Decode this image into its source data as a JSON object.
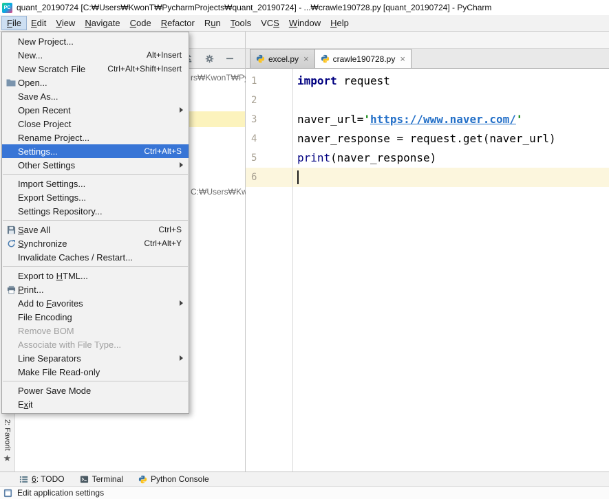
{
  "title_bar": {
    "app_icon_text": "PC",
    "title": "quant_20190724 [C:₩Users₩KwonT₩PycharmProjects₩quant_20190724] - ...₩crawle190728.py [quant_20190724] - PyCharm"
  },
  "menu_bar": {
    "items": [
      {
        "label": "File",
        "mnemonic": "F",
        "active": true
      },
      {
        "label": "Edit",
        "mnemonic": "E"
      },
      {
        "label": "View",
        "mnemonic": "V"
      },
      {
        "label": "Navigate",
        "mnemonic": "N"
      },
      {
        "label": "Code",
        "mnemonic": "C"
      },
      {
        "label": "Refactor",
        "mnemonic": "R"
      },
      {
        "label": "Run",
        "mnemonic": "u"
      },
      {
        "label": "Tools",
        "mnemonic": "T"
      },
      {
        "label": "VCS",
        "mnemonic": "S"
      },
      {
        "label": "Window",
        "mnemonic": "W"
      },
      {
        "label": "Help",
        "mnemonic": "H"
      }
    ]
  },
  "file_menu": {
    "groups": [
      {
        "items": [
          {
            "label": "New Project..."
          },
          {
            "label": "New...",
            "shortcut": "Alt+Insert"
          },
          {
            "label": "New Scratch File",
            "shortcut": "Ctrl+Alt+Shift+Insert"
          },
          {
            "label": "Open...",
            "icon": "folder-icon"
          },
          {
            "label": "Save As..."
          },
          {
            "label": "Open Recent",
            "submenu": true
          },
          {
            "label": "Close Project"
          },
          {
            "label": "Rename Project..."
          },
          {
            "label": "Settings...",
            "shortcut": "Ctrl+Alt+S",
            "selected": true
          },
          {
            "label": "Other Settings",
            "submenu": true
          }
        ]
      },
      {
        "items": [
          {
            "label": "Import Settings..."
          },
          {
            "label": "Export Settings..."
          },
          {
            "label": "Settings Repository..."
          }
        ]
      },
      {
        "items": [
          {
            "label": "Save All",
            "mnemonic": "S",
            "shortcut": "Ctrl+S",
            "icon": "save-icon"
          },
          {
            "label": "Synchronize",
            "mnemonic": "S",
            "shortcut": "Ctrl+Alt+Y",
            "icon": "sync-icon"
          },
          {
            "label": "Invalidate Caches / Restart..."
          }
        ]
      },
      {
        "items": [
          {
            "label": "Export to HTML...",
            "mnemonic": "H"
          },
          {
            "label": "Print...",
            "mnemonic": "P",
            "icon": "printer-icon"
          },
          {
            "label": "Add to Favorites",
            "mnemonic": "F",
            "submenu": true
          },
          {
            "label": "File Encoding"
          },
          {
            "label": "Remove BOM",
            "disabled": true
          },
          {
            "label": "Associate with File Type...",
            "disabled": true
          },
          {
            "label": "Line Separators",
            "submenu": true
          },
          {
            "label": "Make File Read-only"
          }
        ]
      },
      {
        "items": [
          {
            "label": "Power Save Mode"
          },
          {
            "label": "Exit",
            "mnemonic": "x"
          }
        ]
      }
    ]
  },
  "project_panel": {
    "path_fragment_top": "rs₩KwonT₩Py",
    "path_fragment_bottom": "C:₩Users₩Kwo"
  },
  "left_stripe": {
    "favorites_label": "2: Favorit"
  },
  "editor": {
    "tabs": [
      {
        "label": "excel.py",
        "active": false
      },
      {
        "label": "crawle190728.py",
        "active": true
      }
    ],
    "current_line": 6,
    "lines": [
      {
        "n": "1",
        "segments": [
          {
            "t": "import",
            "c": "kw"
          },
          {
            "t": " request",
            "c": "plain"
          }
        ]
      },
      {
        "n": "2",
        "segments": []
      },
      {
        "n": "3",
        "segments": [
          {
            "t": "naver_url=",
            "c": "plain"
          },
          {
            "t": "'",
            "c": "str"
          },
          {
            "t": "https://www.naver.com/",
            "c": "url"
          },
          {
            "t": "'",
            "c": "str"
          }
        ]
      },
      {
        "n": "4",
        "segments": [
          {
            "t": "naver_response = request.get(naver_url)",
            "c": "plain"
          }
        ]
      },
      {
        "n": "5",
        "segments": [
          {
            "t": "print",
            "c": "builtin"
          },
          {
            "t": "(naver_response)",
            "c": "plain"
          }
        ]
      },
      {
        "n": "6",
        "segments": [],
        "highlight": true
      }
    ]
  },
  "toolwindow_bar": {
    "buttons": [
      {
        "label": "6: TODO",
        "mnemonic": "6",
        "icon": "todo-icon"
      },
      {
        "label": "Terminal",
        "icon": "terminal-icon"
      },
      {
        "label": "Python Console",
        "icon": "python-icon"
      }
    ]
  },
  "status_bar": {
    "hint": "Edit application settings"
  },
  "icons": {
    "close_tab": "×",
    "favorites_star": "★"
  },
  "colors": {
    "menu_selection": "#3875d6",
    "caret_line": "#fcf6dd",
    "project_selection": "#fcf3bd",
    "keyword": "#000080",
    "string": "#008000",
    "url_link": "#2470c8"
  }
}
